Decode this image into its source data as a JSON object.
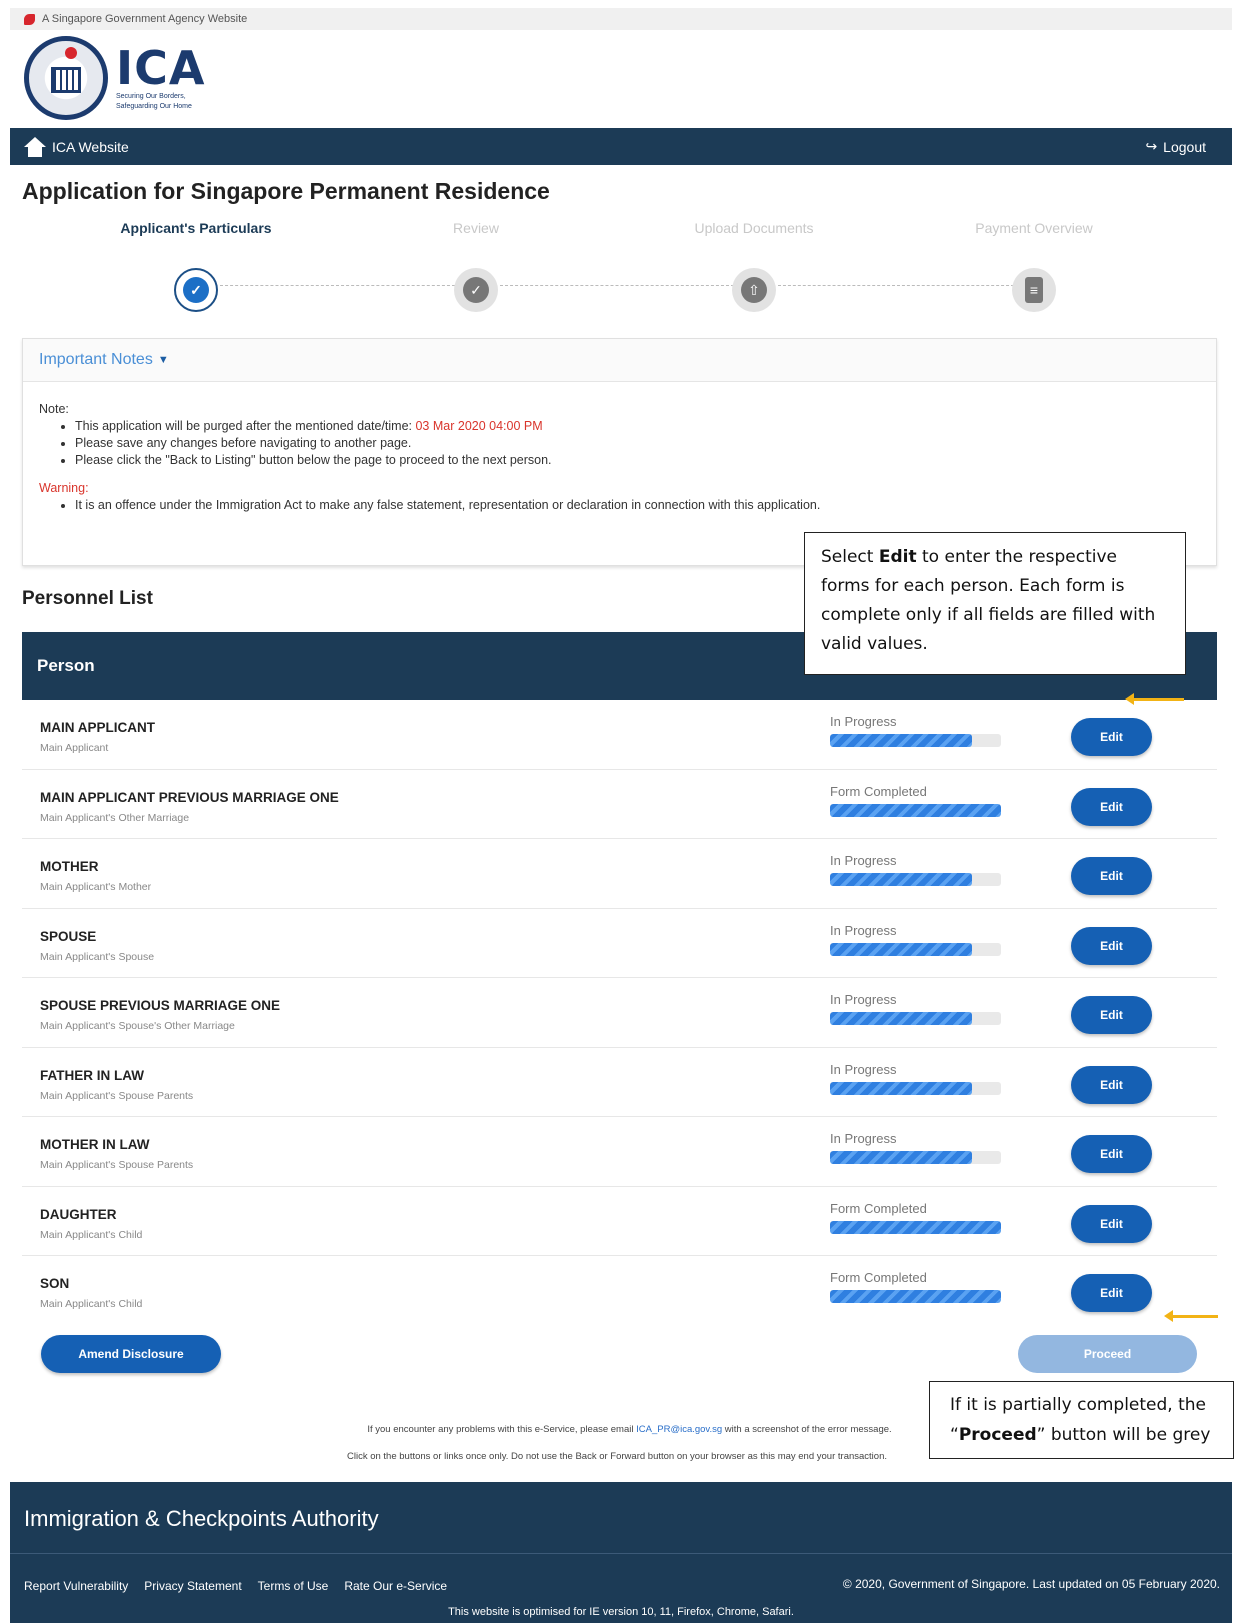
{
  "gov_banner": "A Singapore Government Agency Website",
  "logo": {
    "text": "ICA",
    "tagline_1": "Securing Our Borders,",
    "tagline_2": "Safeguarding Our Home"
  },
  "nav": {
    "home_label": "ICA Website",
    "logout_label": "Logout"
  },
  "page_title": "Application for Singapore Permanent Residence",
  "steps": [
    {
      "label": "Applicant's Particulars",
      "active": true
    },
    {
      "label": "Review",
      "active": false
    },
    {
      "label": "Upload Documents",
      "active": false
    },
    {
      "label": "Payment Overview",
      "active": false
    }
  ],
  "notes": {
    "header": "Important Notes",
    "note_label": "Note:",
    "note_1_prefix": "This application will be purged after the mentioned date/time: ",
    "note_1_date": "03 Mar 2020 04:00 PM",
    "note_2": "Please save any changes before navigating to another page.",
    "note_3": "Please click the \"Back to Listing\" button below the page to proceed to the next person.",
    "warning_label": "Warning:",
    "warning_1": "It is an offence under the Immigration Act to make any false statement, representation or declaration in connection with this application."
  },
  "callouts": {
    "edit_pre": "Select ",
    "edit_bold": "Edit",
    "edit_post": " to enter the respective forms for each person. Each form is complete only if all fields are filled with valid values.",
    "proceed_line1": "If it is partially completed, the",
    "proceed_open": "“",
    "proceed_bold": "Proceed",
    "proceed_close": "” button will be grey"
  },
  "section_title": "Personnel List",
  "table_header": "Person",
  "edit_label": "Edit",
  "rows": [
    {
      "name": "MAIN APPLICANT",
      "relation": "Main Applicant",
      "status": "In Progress",
      "progress": 0.83
    },
    {
      "name": "MAIN APPLICANT PREVIOUS MARRIAGE ONE",
      "relation": "Main Applicant's Other Marriage",
      "status": "Form Completed",
      "progress": 1.0
    },
    {
      "name": "MOTHER",
      "relation": "Main Applicant's Mother",
      "status": "In Progress",
      "progress": 0.83
    },
    {
      "name": "SPOUSE",
      "relation": "Main Applicant's Spouse",
      "status": "In Progress",
      "progress": 0.83
    },
    {
      "name": "SPOUSE PREVIOUS MARRIAGE ONE",
      "relation": "Main Applicant's Spouse's Other Marriage",
      "status": "In Progress",
      "progress": 0.83
    },
    {
      "name": "FATHER IN LAW",
      "relation": "Main Applicant's Spouse Parents",
      "status": "In Progress",
      "progress": 0.83
    },
    {
      "name": "MOTHER IN LAW",
      "relation": "Main Applicant's Spouse Parents",
      "status": "In Progress",
      "progress": 0.83
    },
    {
      "name": "DAUGHTER",
      "relation": "Main Applicant's Child",
      "status": "Form Completed",
      "progress": 1.0
    },
    {
      "name": "SON",
      "relation": "Main Applicant's Child",
      "status": "Form Completed",
      "progress": 1.0
    }
  ],
  "buttons": {
    "amend": "Amend Disclosure",
    "proceed": "Proceed"
  },
  "help": {
    "line1_pre": "If you encounter any problems with this e-Service, please email ",
    "email": "ICA_PR@ica.gov.sg",
    "line1_post": " with a screenshot of the error message.",
    "line2": "Click on the buttons or links once only. Do not use the Back or Forward button on your browser as this may end your transaction."
  },
  "footer": {
    "org": "Immigration & Checkpoints Authority",
    "links": [
      "Report Vulnerability",
      "Privacy Statement",
      "Terms of Use",
      "Rate Our e-Service"
    ],
    "copyright": "© 2020, Government of Singapore. Last updated on 05 February 2020.",
    "optimised": "This website is optimised for IE version 10, 11, Firefox, Chrome, Safari."
  },
  "colors": {
    "navy": "#1c3b56",
    "button_blue": "#1560b4",
    "disabled_blue": "#93b7e0",
    "warning_red": "#d9352c",
    "arrow_yellow": "#f2b315"
  },
  "icons": {
    "home": "home-icon",
    "logout": "logout-icon",
    "notes_toggle": "chevron-down-icon"
  }
}
